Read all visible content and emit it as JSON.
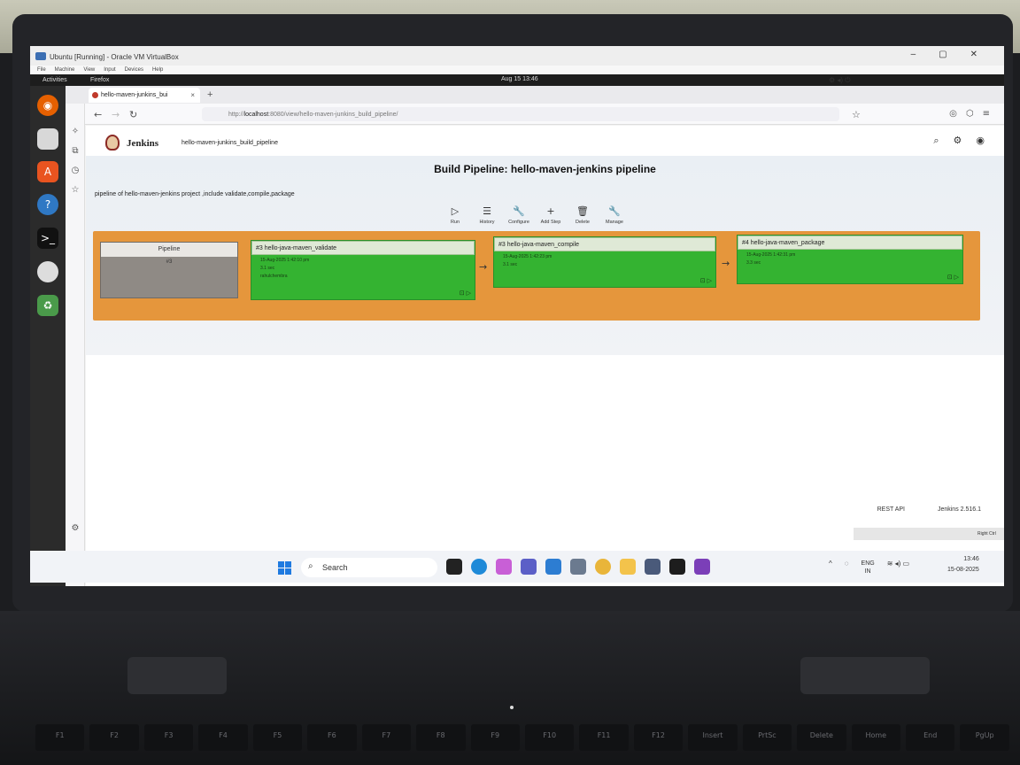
{
  "vbox": {
    "title": "Ubuntu [Running] - Oracle VM VirtualBox",
    "menu": [
      "File",
      "Machine",
      "View",
      "Input",
      "Devices",
      "Help"
    ],
    "status_text": "Right Ctrl"
  },
  "ubuntu": {
    "activities": "Activities",
    "app_name": "Firefox",
    "clock": "Aug 15  13:46"
  },
  "firefox": {
    "tab_title": "hello-maven-junkins_bui",
    "url_prefix": "http://",
    "url_host": "localhost",
    "url_rest": ":8080/view/hello-maven-junkins_build_pipeline/"
  },
  "jenkins": {
    "brand": "Jenkins",
    "breadcrumb": "hello-maven-junkins_build_pipeline",
    "page_title": "Build Pipeline: hello-maven-jenkins pipeline",
    "description": "pipeline of hello-maven-jenkins project ,include validate,compile,package",
    "tools": [
      {
        "label": "Run",
        "icon": "play-icon"
      },
      {
        "label": "History",
        "icon": "history-icon"
      },
      {
        "label": "Configure",
        "icon": "wrench-icon"
      },
      {
        "label": "Add Step",
        "icon": "plus-icon"
      },
      {
        "label": "Delete",
        "icon": "trash-icon"
      },
      {
        "label": "Manage",
        "icon": "wrench-icon"
      }
    ],
    "pipeline_box": {
      "label": "Pipeline",
      "number": "#3"
    },
    "stages": [
      {
        "title": "#3 hello-java-maven_validate",
        "time": "15-Aug-2025 1:42:10 pm",
        "duration": "3.1 sec",
        "user": "rahulchembra"
      },
      {
        "title": "#3 hello-java-maven_compile",
        "time": "15-Aug-2025 1:42:23 pm",
        "duration": "3.1 sec"
      },
      {
        "title": "#4 hello-java-maven_package",
        "time": "15-Aug-2025 1:42:31 pm",
        "duration": "3.3 sec"
      }
    ],
    "footer": {
      "rest_api": "REST API",
      "version": "Jenkins 2.516.1"
    },
    "colors": {
      "pipeline_bg": "#e5963c",
      "stage_success": "#34b331"
    }
  },
  "windows": {
    "search": "Search",
    "lang_top": "ENG",
    "lang_bottom": "IN",
    "time": "13:46",
    "date": "15-08-2025"
  },
  "keyboard": {
    "fkeys": [
      "F1",
      "F2",
      "F3",
      "F4",
      "F5",
      "F6",
      "F7",
      "F8",
      "F9",
      "F10",
      "F11",
      "F12",
      "Insert",
      "PrtSc",
      "Delete",
      "Home",
      "End",
      "PgUp"
    ]
  }
}
